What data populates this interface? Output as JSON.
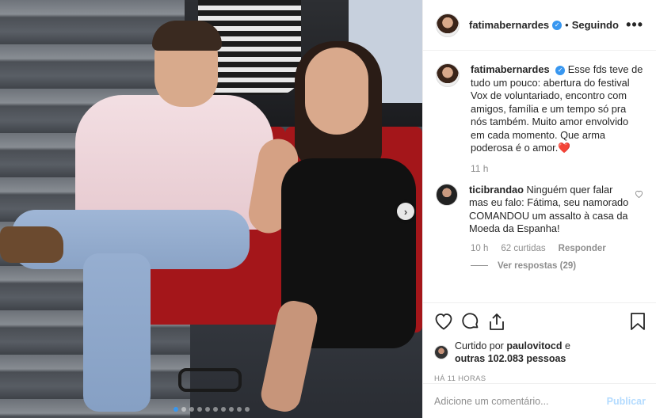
{
  "header": {
    "username": "fatimabernardes",
    "verified_icon": "verified-badge-icon",
    "bullet": "•",
    "follow_status": "Seguindo",
    "more_label": "•••"
  },
  "post": {
    "photo_nav_next": "›",
    "carousel": {
      "count": 10,
      "active_index": 0
    },
    "accent_color": "#3897f0"
  },
  "caption": {
    "username": "fatimabernardes",
    "text": "Esse fds teve de tudo um pouco: abertura do festival Vox de voluntariado, encontro com amigos, família e um tempo só pra nós também. Muito amor envolvido em cada momento. Que arma poderosa é o amor.",
    "emoji": "❤️",
    "time": "11 h"
  },
  "comments": [
    {
      "username": "ticibrandao",
      "text": "Ninguém quer falar mas eu falo: Fátima, seu namorado COMANDOU um assalto à casa da Moeda da Espanha!",
      "time": "10 h",
      "likes": "62 curtidas",
      "reply_label": "Responder",
      "view_replies": "Ver respostas (29)"
    }
  ],
  "likes": {
    "prefix": "Curtido por",
    "liked_by": "paulovitocd",
    "middle": "e",
    "others": "outras 102.083 pessoas"
  },
  "timestamp": "HÁ 11 HORAS",
  "add_comment": {
    "placeholder": "Adicione um comentário...",
    "publish_label": "Publicar"
  }
}
